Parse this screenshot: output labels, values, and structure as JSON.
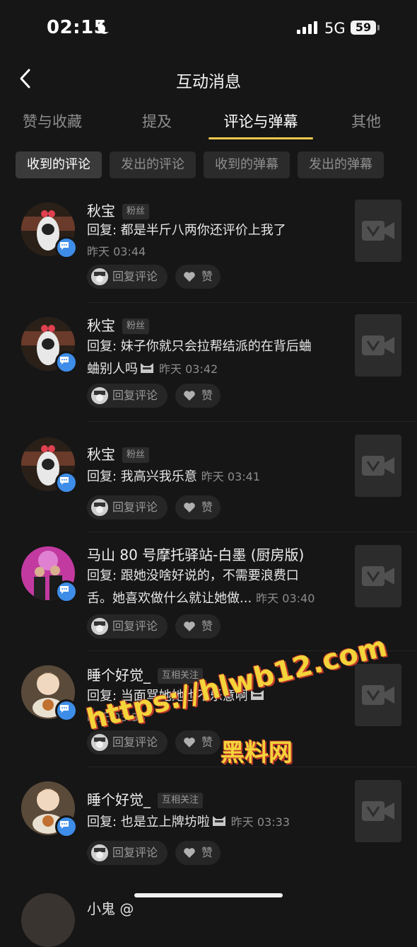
{
  "status_bar": {
    "time": "02:15",
    "network": "5G",
    "battery": "59"
  },
  "header": {
    "title": "互动消息"
  },
  "tabs": [
    {
      "label": "赞与收藏"
    },
    {
      "label": "提及"
    },
    {
      "label": "评论与弹幕",
      "active": true
    },
    {
      "label": "其他"
    }
  ],
  "filters": [
    {
      "label": "收到的评论",
      "active": true
    },
    {
      "label": "发出的评论"
    },
    {
      "label": "收到的弹幕"
    },
    {
      "label": "发出的弹幕"
    }
  ],
  "actions": {
    "reply": "回复评论",
    "like": "赞"
  },
  "comments": [
    {
      "name": "秋宝",
      "tag": "粉丝",
      "text": "回复: 都是半斤八两你还评价上我了",
      "time": "昨天 03:44"
    },
    {
      "name": "秋宝",
      "tag": "粉丝",
      "text_line1": "回复: 妹子你就只会拉帮结派的在背后蛐",
      "text_line2": "蛐别人吗",
      "time": "昨天 03:42"
    },
    {
      "name": "秋宝",
      "tag": "粉丝",
      "text": "回复: 我高兴我乐意",
      "time": "昨天 03:41"
    },
    {
      "name": "马山 80 号摩托驿站-白墨 (厨房版)",
      "text_line1": "回复: 跟她没啥好说的，不需要浪费口",
      "text_line2": "舌。她喜欢做什么就让她做...",
      "time": "昨天 03:40"
    },
    {
      "name": "睡个好觉_",
      "tag": "互相关注",
      "text": "回复: 当面骂她她也不乐意啊",
      "time": "昨天 03:33"
    },
    {
      "name": "睡个好觉_",
      "tag": "互相关注",
      "text": "回复: 也是立上牌坊啦",
      "time": "昨天 03:33"
    }
  ],
  "partial_next": {
    "name": "小鬼 @"
  },
  "watermark": {
    "url": "https://hlwb12.com",
    "label": "黑料网"
  }
}
